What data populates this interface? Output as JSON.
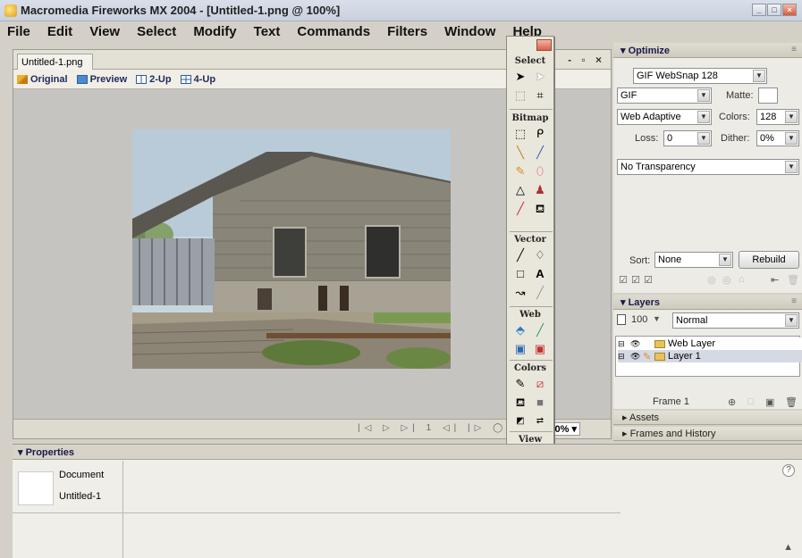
{
  "window": {
    "title": "Macromedia Fireworks MX 2004 - [Untitled-1.png @ 100%]",
    "controls": [
      "_",
      "□",
      "×"
    ]
  },
  "menu": [
    "File",
    "Edit",
    "View",
    "Select",
    "Modify",
    "Text",
    "Commands",
    "Filters",
    "Window",
    "Help"
  ],
  "document": {
    "tab_label": "Untitled-1.png",
    "window_controls": "- ▫ ×",
    "view_tabs": [
      "Original",
      "Preview",
      "2-Up",
      "4-Up"
    ],
    "playback_controls": "|◁ ▷ ▷| 1 ◁| |▷ ◯",
    "frame_number": "1",
    "zoom": "100%"
  },
  "tools": {
    "sections": [
      {
        "title": "Select",
        "tools": [
          "pointer-tool",
          "subselection-tool",
          "scale-tool",
          "crop-tool"
        ]
      },
      {
        "title": "Bitmap",
        "tools": [
          "marquee-tool",
          "lasso-tool",
          "magic-wand-tool",
          "brush-tool",
          "pencil-tool",
          "eraser-tool",
          "blur-tool",
          "rubber-stamp-tool",
          "eyedropper-tool",
          "paint-bucket-tool"
        ]
      },
      {
        "title": "Vector",
        "tools": [
          "line-tool",
          "pen-tool",
          "rectangle-tool",
          "text-tool",
          "freeform-tool",
          "knife-tool"
        ]
      },
      {
        "title": "Web",
        "tools": [
          "hotspot-tool",
          "slice-tool",
          "hide-slices-tool",
          "show-slices-tool"
        ]
      },
      {
        "title": "Colors",
        "tools": [
          "stroke-color",
          "stroke-swatch",
          "fill-color",
          "fill-swatch",
          "default-colors",
          "swap-colors"
        ]
      },
      {
        "title": "View",
        "tools": [
          "standard-screen-mode",
          "full-screen-menus-mode",
          "full-screen-mode",
          "hand-tool",
          "zoom-tool"
        ]
      }
    ]
  },
  "optimize": {
    "header": "Optimize",
    "preset": "GIF WebSnap 128",
    "format": "GIF",
    "matte_label": "Matte:",
    "palette": "Web Adaptive",
    "colors_label": "Colors:",
    "colors_value": "128",
    "loss_label": "Loss:",
    "loss_value": "0",
    "dither_label": "Dither:",
    "dither_value": "0%",
    "transparency": "No Transparency",
    "sort_label": "Sort:",
    "sort_value": "None",
    "rebuild_label": "Rebuild"
  },
  "layers": {
    "header": "Layers",
    "opacity": "100",
    "blend_mode": "Normal",
    "items": [
      {
        "name": "Web Layer"
      },
      {
        "name": "Layer 1"
      }
    ],
    "frame_label": "Frame 1"
  },
  "collapsed_panels": [
    "Assets",
    "Frames and History"
  ],
  "properties": {
    "header": "Properties",
    "doc_type": "Document",
    "doc_name": "Untitled-1",
    "help": "?"
  },
  "colors": {
    "accent": "#1a1a4a",
    "panel_bg": "#ecebe5",
    "canvas_bg": "#c5c4c0"
  }
}
